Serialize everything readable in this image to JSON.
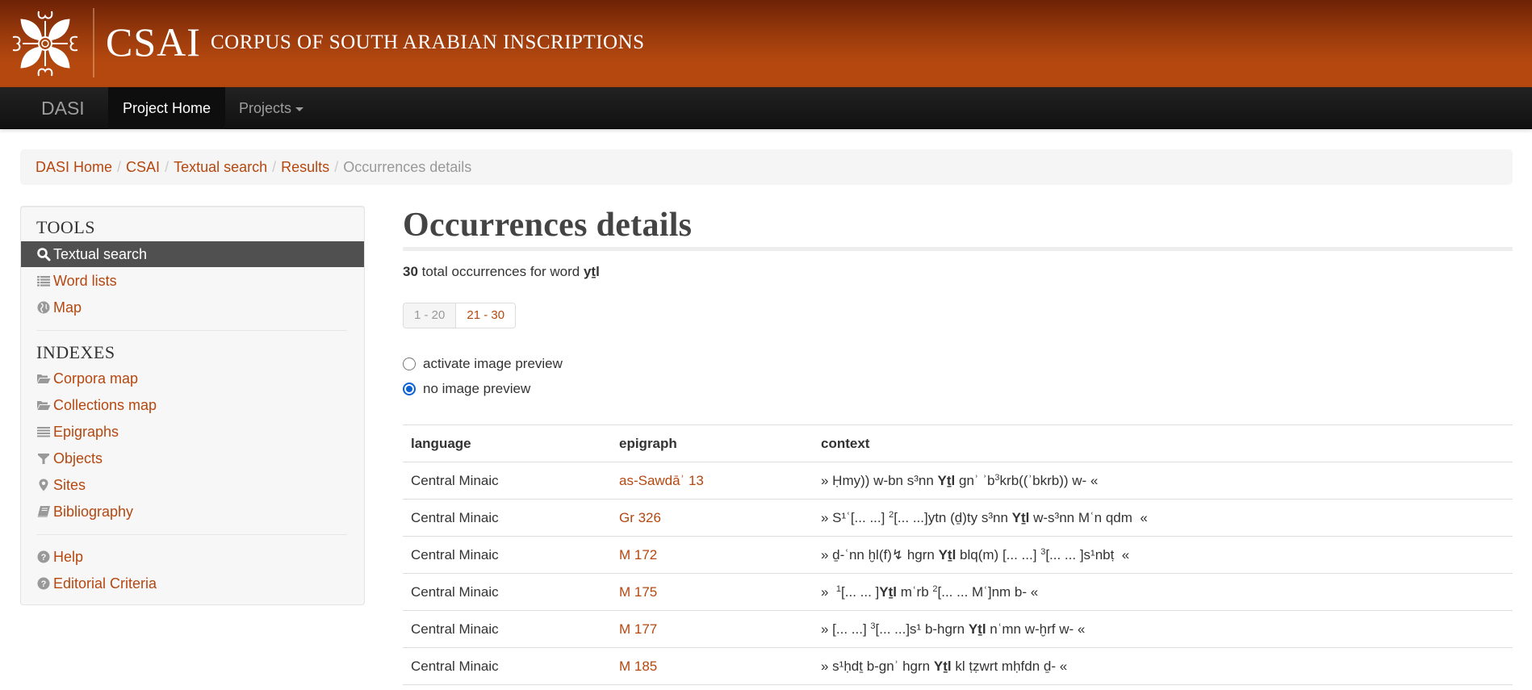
{
  "header": {
    "brand": "CSAI",
    "subtitle": "CORPUS OF SOUTH ARABIAN INSCRIPTIONS"
  },
  "navbar": {
    "brand": "DASI",
    "items": [
      {
        "label": "Project Home",
        "active": true
      },
      {
        "label": "Projects",
        "dropdown": true
      }
    ]
  },
  "breadcrumb": {
    "items": [
      "DASI Home",
      "CSAI",
      "Textual search",
      "Results"
    ],
    "current": "Occurrences details",
    "separator": "/"
  },
  "sidebar": {
    "tools_heading": "TOOLS",
    "tools": [
      {
        "label": "Textual search",
        "icon": "search-icon",
        "active": true
      },
      {
        "label": "Word lists",
        "icon": "list-icon"
      },
      {
        "label": "Map",
        "icon": "globe-icon"
      }
    ],
    "indexes_heading": "INDEXES",
    "indexes": [
      {
        "label": "Corpora map",
        "icon": "folder-open-icon"
      },
      {
        "label": "Collections map",
        "icon": "folder-open-icon"
      },
      {
        "label": "Epigraphs",
        "icon": "align-justify-icon"
      },
      {
        "label": "Objects",
        "icon": "filter-icon"
      },
      {
        "label": "Sites",
        "icon": "map-marker-icon"
      },
      {
        "label": "Bibliography",
        "icon": "book-icon"
      }
    ],
    "help": [
      {
        "label": "Help",
        "icon": "question-circle-icon"
      },
      {
        "label": "Editorial Criteria",
        "icon": "question-circle-icon"
      }
    ]
  },
  "main": {
    "title": "Occurrences details",
    "summary": {
      "count": "30",
      "text": " total occurrences for word ",
      "word": "yṯl"
    },
    "pagination": [
      {
        "label": "1 - 20",
        "current": true
      },
      {
        "label": "21 - 30",
        "current": false
      }
    ],
    "preview_options": [
      {
        "label": "activate image preview",
        "checked": false
      },
      {
        "label": "no image preview",
        "checked": true
      }
    ],
    "table": {
      "columns": [
        "language",
        "epigraph",
        "context"
      ],
      "rows": [
        {
          "language": "Central Minaic",
          "epigraph": "as-Sawdāʾ 13",
          "context": [
            {
              "t": "» Ḥmy)) w-bn s³nn "
            },
            {
              "b": "Yṯl"
            },
            {
              "t": " gnʾ ʾb"
            },
            {
              "s": "3"
            },
            {
              "t": "krb((ʾbkrb)) w- «"
            }
          ]
        },
        {
          "language": "Central Minaic",
          "epigraph": "Gr 326",
          "context": [
            {
              "t": "» S¹ʿ[... ...] "
            },
            {
              "s": "2"
            },
            {
              "t": "[... ...]ytn (ḏ)ty s³nn "
            },
            {
              "b": "Yṯl"
            },
            {
              "t": " w-s³nn Mʿn qdm  «"
            }
          ]
        },
        {
          "language": "Central Minaic",
          "epigraph": "M 172",
          "context": [
            {
              "t": "» ḏ-ʿnn ḫl(f)↯ hgrn "
            },
            {
              "b": "Yṯl"
            },
            {
              "t": " blq(m) [... ...] "
            },
            {
              "s": "3"
            },
            {
              "t": "[... ... ]s¹nbṭ  «"
            }
          ]
        },
        {
          "language": "Central Minaic",
          "epigraph": "M 175",
          "context": [
            {
              "t": "»  "
            },
            {
              "s": "1"
            },
            {
              "t": "[... ... ]"
            },
            {
              "b": "Yṯl"
            },
            {
              "t": " mʿrb "
            },
            {
              "s": "2"
            },
            {
              "t": "[... ... Mʿ]nm b- «"
            }
          ]
        },
        {
          "language": "Central Minaic",
          "epigraph": "M 177",
          "context": [
            {
              "t": "» [... ...] "
            },
            {
              "s": "3"
            },
            {
              "t": "[... ...]s¹ b-hgrn "
            },
            {
              "b": "Yṯl"
            },
            {
              "t": " nʿmn w-ḫrf w- «"
            }
          ]
        },
        {
          "language": "Central Minaic",
          "epigraph": "M 185",
          "context": [
            {
              "t": "» s¹ḥdṯ b-gnʾ hgrn "
            },
            {
              "b": "Yṯl"
            },
            {
              "t": " kl ṭẓwrt mḥfdn ḏ- «"
            }
          ]
        }
      ]
    }
  },
  "colors": {
    "link": "#b5470f",
    "banner": "#b4480f",
    "navbar": "#1a1a1a",
    "active_sidebar": "#505050",
    "radio_checked": "#0a63d6"
  }
}
